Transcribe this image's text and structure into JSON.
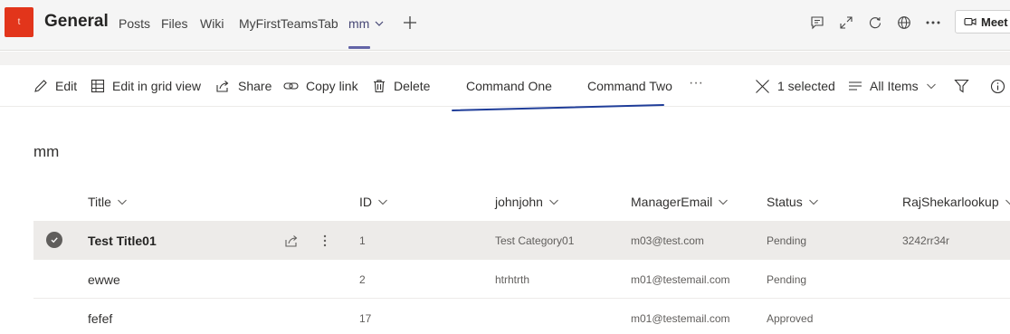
{
  "team": {
    "avatar_letter": "t",
    "avatar_color": "#e2351b",
    "channel_name": "General"
  },
  "tabs": [
    {
      "label": "Posts"
    },
    {
      "label": "Files"
    },
    {
      "label": "Wiki"
    },
    {
      "label": "MyFirstTeamsTab"
    },
    {
      "label": "mm",
      "active": true
    }
  ],
  "header_icons": [
    "conversation-icon",
    "expand-icon",
    "refresh-icon",
    "globe-icon",
    "more-icon"
  ],
  "meet_button": {
    "label": "Meet"
  },
  "command_bar": {
    "edit": "Edit",
    "edit_grid": "Edit in grid view",
    "share": "Share",
    "copy_link": "Copy link",
    "delete": "Delete",
    "command_one": "Command One",
    "command_two": "Command Two",
    "overflow": "···",
    "selected_count": "1 selected",
    "view": "All Items"
  },
  "list": {
    "title": "mm",
    "columns": [
      "Title",
      "ID",
      "johnjohn",
      "ManagerEmail",
      "Status",
      "RajShekarlookup"
    ],
    "rows": [
      {
        "title": "Test Title01",
        "id": "1",
        "johnjohn": "Test Category01",
        "manager_email": "m03@test.com",
        "status": "Pending",
        "lookup": "3242rr34r",
        "selected": true
      },
      {
        "title": "ewwe",
        "id": "2",
        "johnjohn": "htrhtrth",
        "manager_email": "m01@testemail.com",
        "status": "Pending",
        "lookup": ""
      },
      {
        "title": "fefef",
        "id": "17",
        "johnjohn": "",
        "manager_email": "m01@testemail.com",
        "status": "Approved",
        "lookup": ""
      }
    ]
  },
  "colors": {
    "accent": "#6264a7",
    "annotation": "#1f3d99"
  }
}
